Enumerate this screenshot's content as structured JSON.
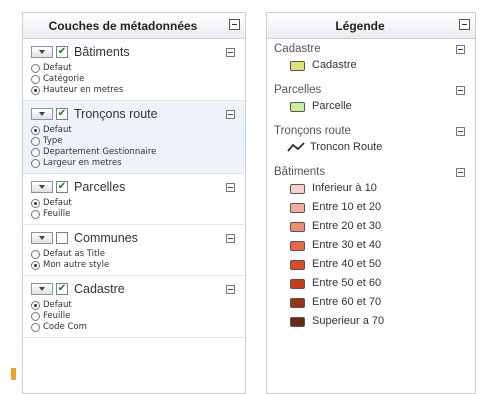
{
  "layers_panel": {
    "title": "Couches de métadonnées",
    "layers": [
      {
        "name": "Bâtiments",
        "checked": true,
        "styles": [
          {
            "label": "Defaut",
            "selected": false
          },
          {
            "label": "Catégorie",
            "selected": false
          },
          {
            "label": "Hauteur en metres",
            "selected": true
          }
        ]
      },
      {
        "name": "Tronçons route",
        "checked": true,
        "selected_row": true,
        "styles": [
          {
            "label": "Defaut",
            "selected": true
          },
          {
            "label": "Type",
            "selected": false
          },
          {
            "label": "Departement Gestionnaire",
            "selected": false
          },
          {
            "label": "Largeur en metres",
            "selected": false
          }
        ]
      },
      {
        "name": "Parcelles",
        "checked": true,
        "styles": [
          {
            "label": "Defaut",
            "selected": true
          },
          {
            "label": "Feuille",
            "selected": false
          }
        ]
      },
      {
        "name": "Communes",
        "checked": false,
        "styles": [
          {
            "label": "Defaut as Title",
            "selected": false
          },
          {
            "label": "Mon autre style",
            "selected": true
          }
        ]
      },
      {
        "name": "Cadastre",
        "checked": true,
        "styles": [
          {
            "label": "Defaut",
            "selected": true
          },
          {
            "label": "Feuille",
            "selected": false
          },
          {
            "label": "Code Com",
            "selected": false
          }
        ]
      }
    ]
  },
  "legend_panel": {
    "title": "Légende",
    "groups": [
      {
        "name": "Cadastre",
        "items": [
          {
            "label": "Cadastre",
            "symbol": "square",
            "color": "#e2e27c"
          }
        ]
      },
      {
        "name": "Parcelles",
        "items": [
          {
            "label": "Parcelle",
            "symbol": "square",
            "color": "#c6ef9e"
          }
        ]
      },
      {
        "name": "Tronçons route",
        "items": [
          {
            "label": "Troncon Route",
            "symbol": "line",
            "color": "#333333"
          }
        ]
      },
      {
        "name": "Bâtiments",
        "items": [
          {
            "label": "Inferieur à 10",
            "symbol": "square",
            "color": "#f9d1c8"
          },
          {
            "label": "Entre 10 et 20",
            "symbol": "square",
            "color": "#f4aa98"
          },
          {
            "label": "Entre 20 et 30",
            "symbol": "square",
            "color": "#f08a70"
          },
          {
            "label": "Entre 30 et 40",
            "symbol": "square",
            "color": "#e8674a"
          },
          {
            "label": "Entre 40 et 50",
            "symbol": "square",
            "color": "#df4a24"
          },
          {
            "label": "Entre 50 et 60",
            "symbol": "square",
            "color": "#c83a18"
          },
          {
            "label": "Entre 60 et 70",
            "symbol": "square",
            "color": "#9a3315"
          },
          {
            "label": "Superieur a 70",
            "symbol": "square",
            "color": "#6a2a18"
          }
        ]
      }
    ]
  },
  "accent_color": "#f0a230"
}
